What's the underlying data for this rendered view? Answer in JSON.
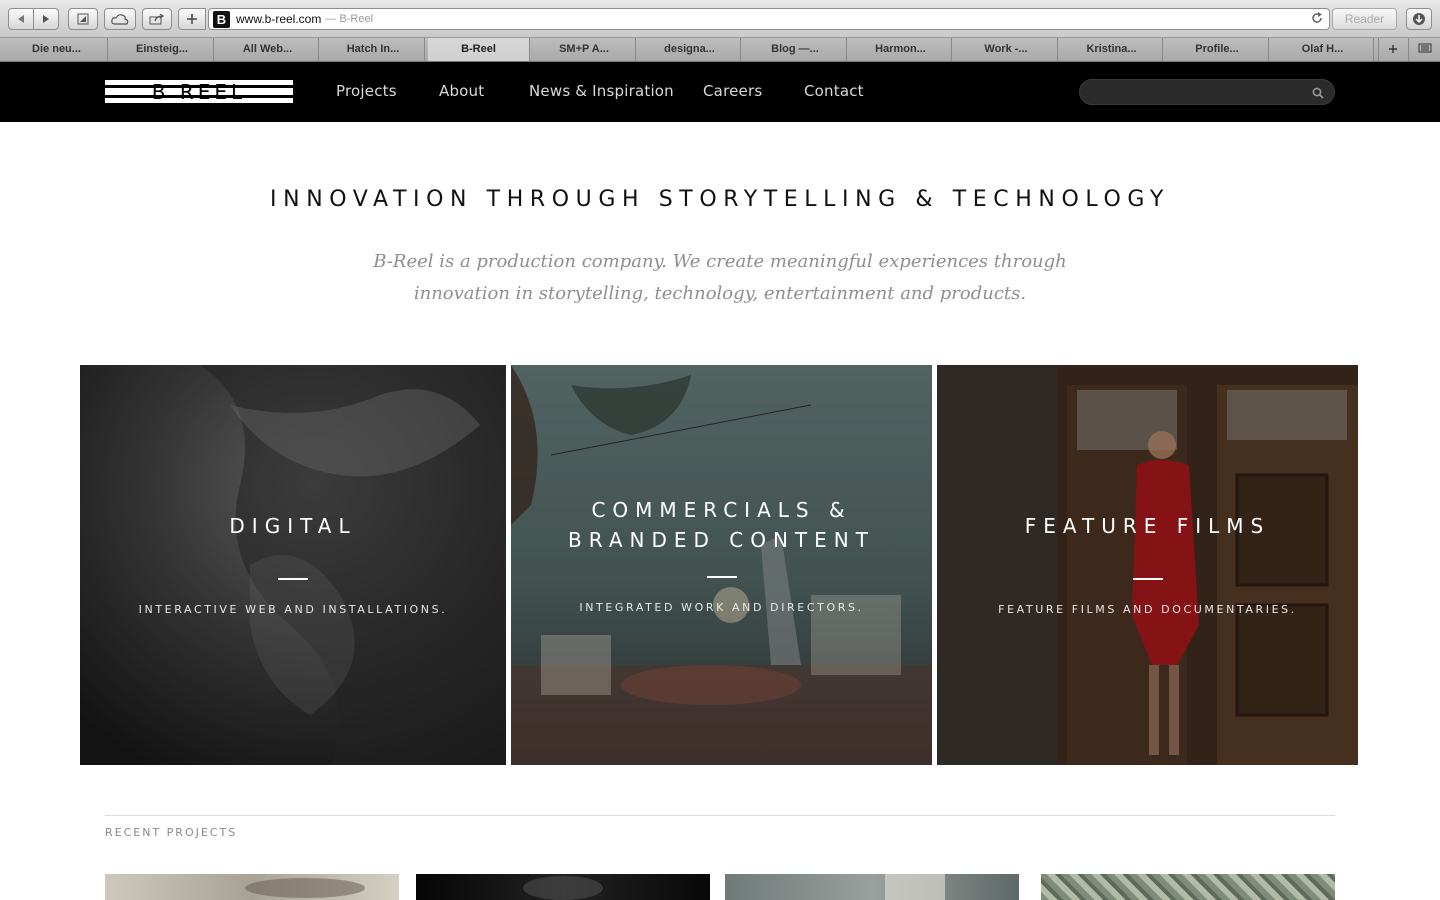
{
  "browser": {
    "url": "www.b-reel.com",
    "page_title": "— B-Reel",
    "reader_label": "Reader",
    "favicon_letter": "B",
    "tabs": [
      "Die neu...",
      "Einsteig...",
      "All Web...",
      "Hatch In...",
      "B-Reel",
      "SM+P A...",
      "designa...",
      "Blog —...",
      "Harmon...",
      "Work -...",
      "Kristina...",
      "Profile...",
      "Olaf H..."
    ],
    "active_tab_index": 4
  },
  "header": {
    "logo_text": "B REEL",
    "nav": [
      "Projects",
      "About",
      "News & Inspiration",
      "Careers",
      "Contact"
    ],
    "search_placeholder": ""
  },
  "hero": {
    "headline": "INNOVATION THROUGH STORYTELLING & TECHNOLOGY",
    "tagline_line1": "B-Reel is a production company. We create meaningful experiences through",
    "tagline_line2": "innovation in storytelling, technology, entertainment and products."
  },
  "panels": [
    {
      "title": "DIGITAL",
      "subtitle": "INTERACTIVE WEB AND INSTALLATIONS."
    },
    {
      "title_line1": "COMMERCIALS &",
      "title_line2": "BRANDED CONTENT",
      "subtitle": "INTEGRATED WORK AND DIRECTORS."
    },
    {
      "title": "FEATURE FILMS",
      "subtitle": "FEATURE FILMS AND DOCUMENTARIES."
    }
  ],
  "recent": {
    "label": "RECENT PROJECTS"
  },
  "colors": {
    "header_bg": "#000000",
    "nav_text": "#d9d9d9",
    "headline": "#111111",
    "tagline": "#8f8f8f"
  }
}
